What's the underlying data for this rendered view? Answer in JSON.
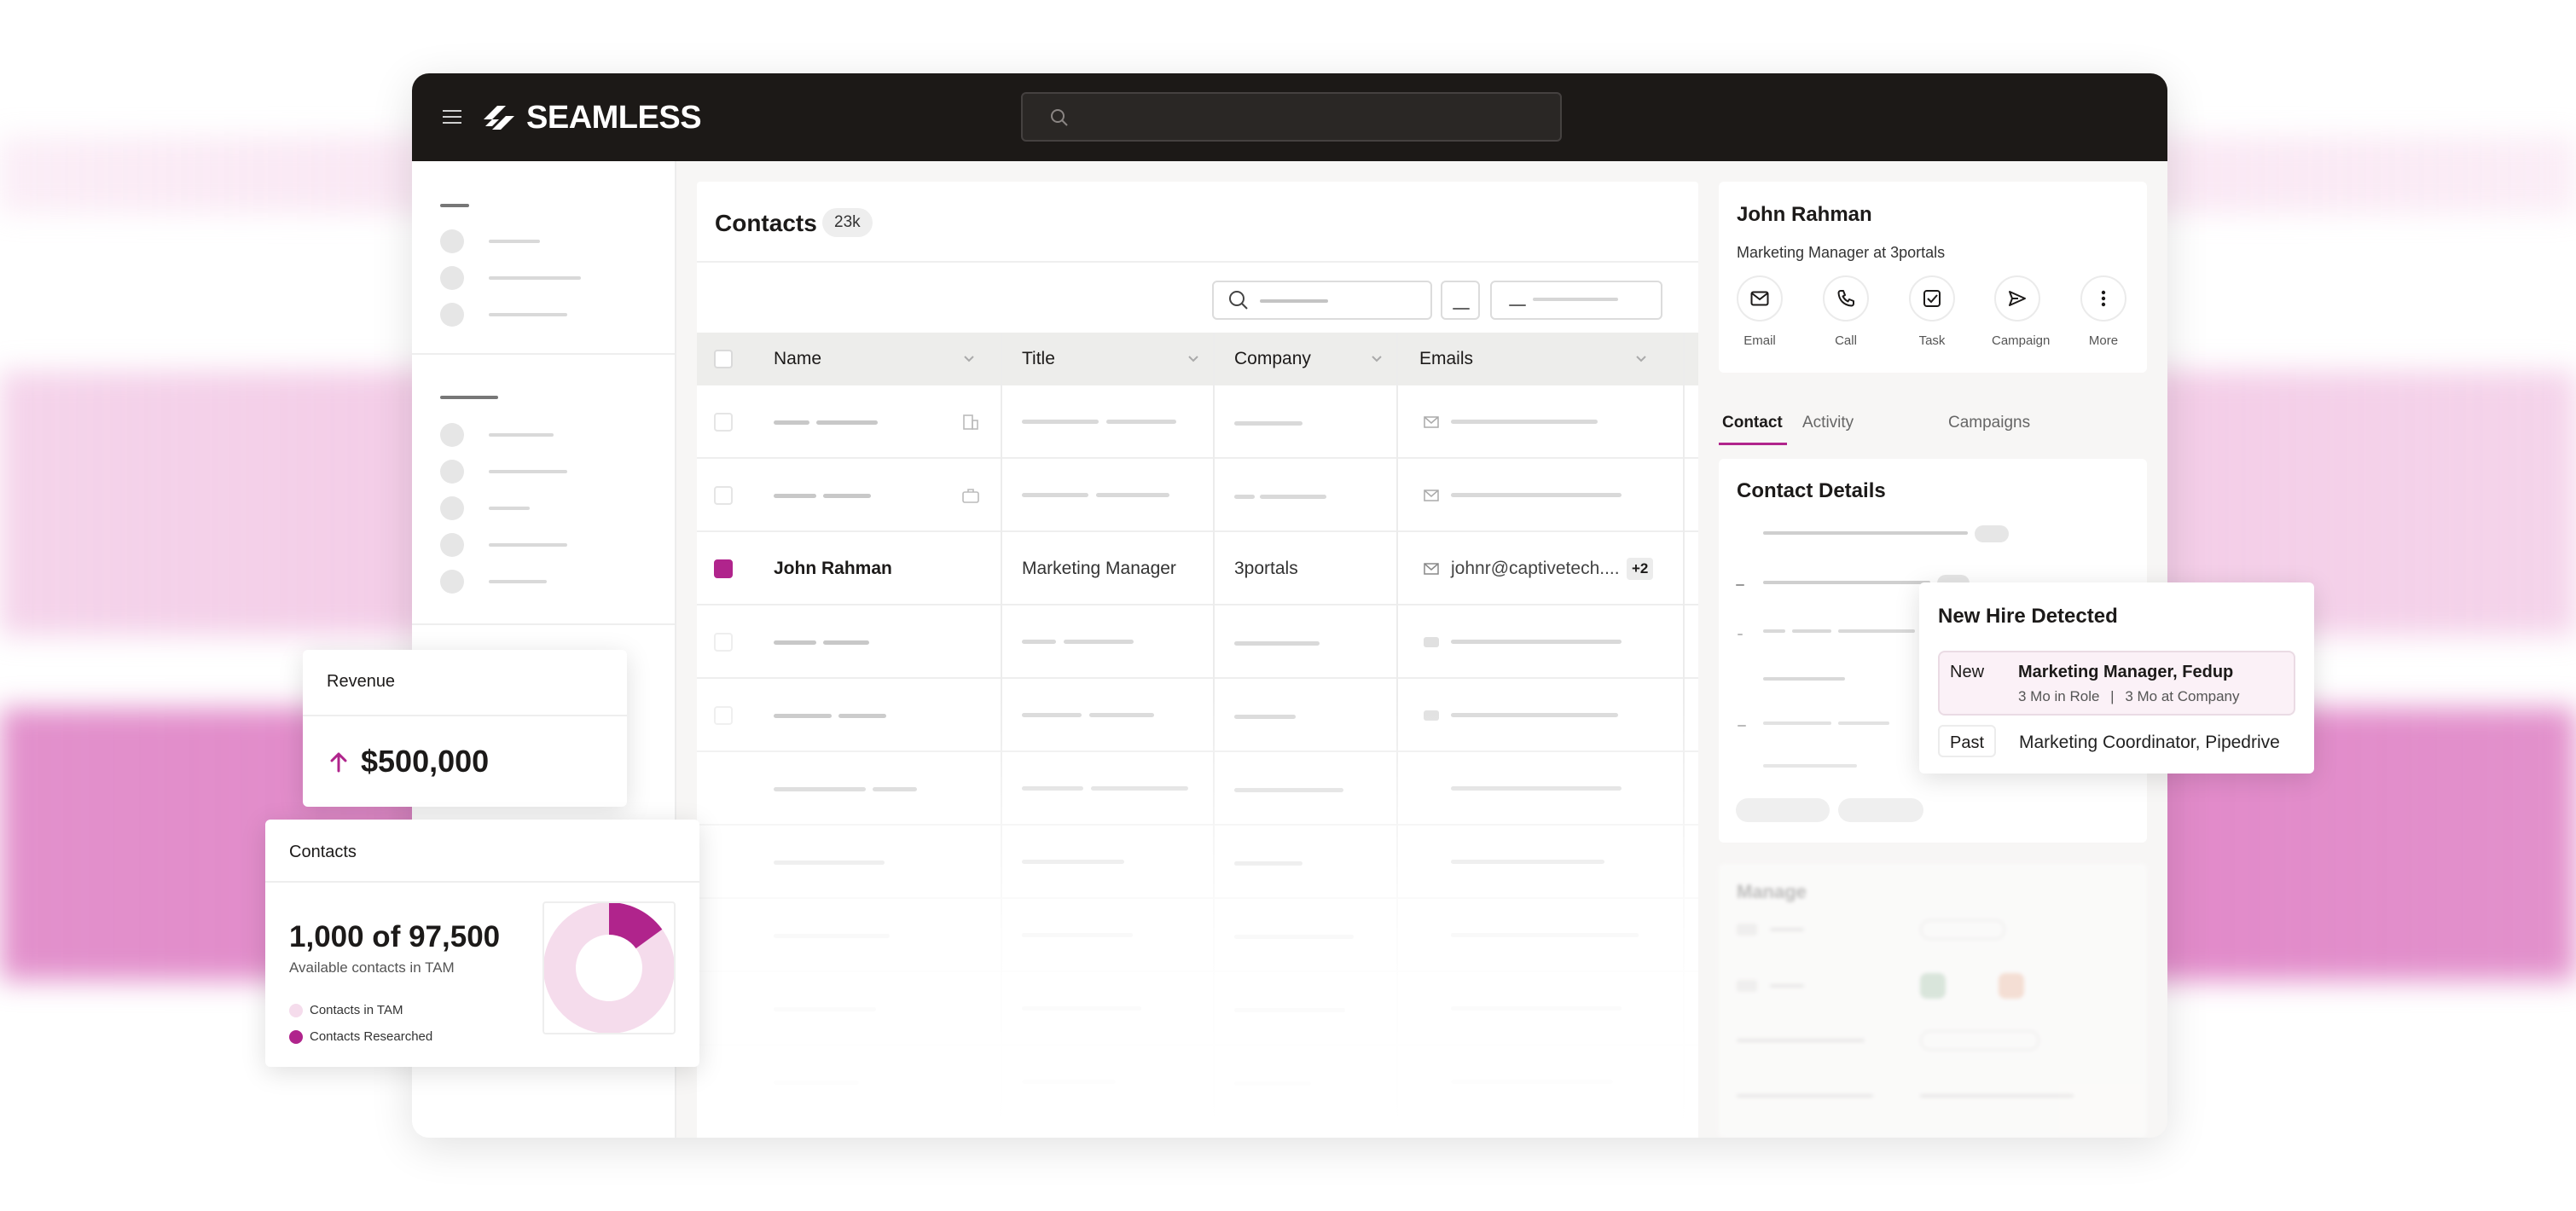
{
  "app": {
    "brand": "SEAMLESS",
    "accent": "#b0248c"
  },
  "main": {
    "title": "Contacts",
    "count_badge": "23k",
    "columns": [
      "Name",
      "Title",
      "Company",
      "Emails"
    ],
    "selected_row": {
      "name": "John Rahman",
      "title": "Marketing Manager",
      "company": "3portals",
      "email": "johnr@captivetech....",
      "extra_emails": "+2"
    }
  },
  "profile": {
    "name": "John Rahman",
    "subtitle": "Marketing Manager at 3portals",
    "actions": [
      {
        "label": "Email",
        "icon": "mail-icon"
      },
      {
        "label": "Call",
        "icon": "phone-icon"
      },
      {
        "label": "Task",
        "icon": "checkbox-icon"
      },
      {
        "label": "Campaign",
        "icon": "send-icon"
      },
      {
        "label": "More",
        "icon": "more-vertical-icon"
      }
    ],
    "tabs": [
      "Contact",
      "Activity",
      "Campaigns"
    ],
    "active_tab": "Contact",
    "details_title": "Contact Details",
    "manage_title": "Manage"
  },
  "new_hire": {
    "title": "New Hire Detected",
    "new_label": "New",
    "new_role": "Marketing Manager, Fedup",
    "new_meta_role": "3 Mo in Role",
    "new_meta_sep": "|",
    "new_meta_company": "3 Mo at Company",
    "past_label": "Past",
    "past_role": "Marketing Coordinator, Pipedrive"
  },
  "revenue": {
    "title": "Revenue",
    "value": "$500,000",
    "trend": "up"
  },
  "contacts_card": {
    "title": "Contacts",
    "value": "1,000 of 97,500",
    "subtitle": "Available contacts in TAM",
    "legend": [
      {
        "label": "Contacts in TAM",
        "color": "#f5dcec"
      },
      {
        "label": "Contacts Researched",
        "color": "#b0248c"
      }
    ],
    "researched_fraction": 0.15
  }
}
